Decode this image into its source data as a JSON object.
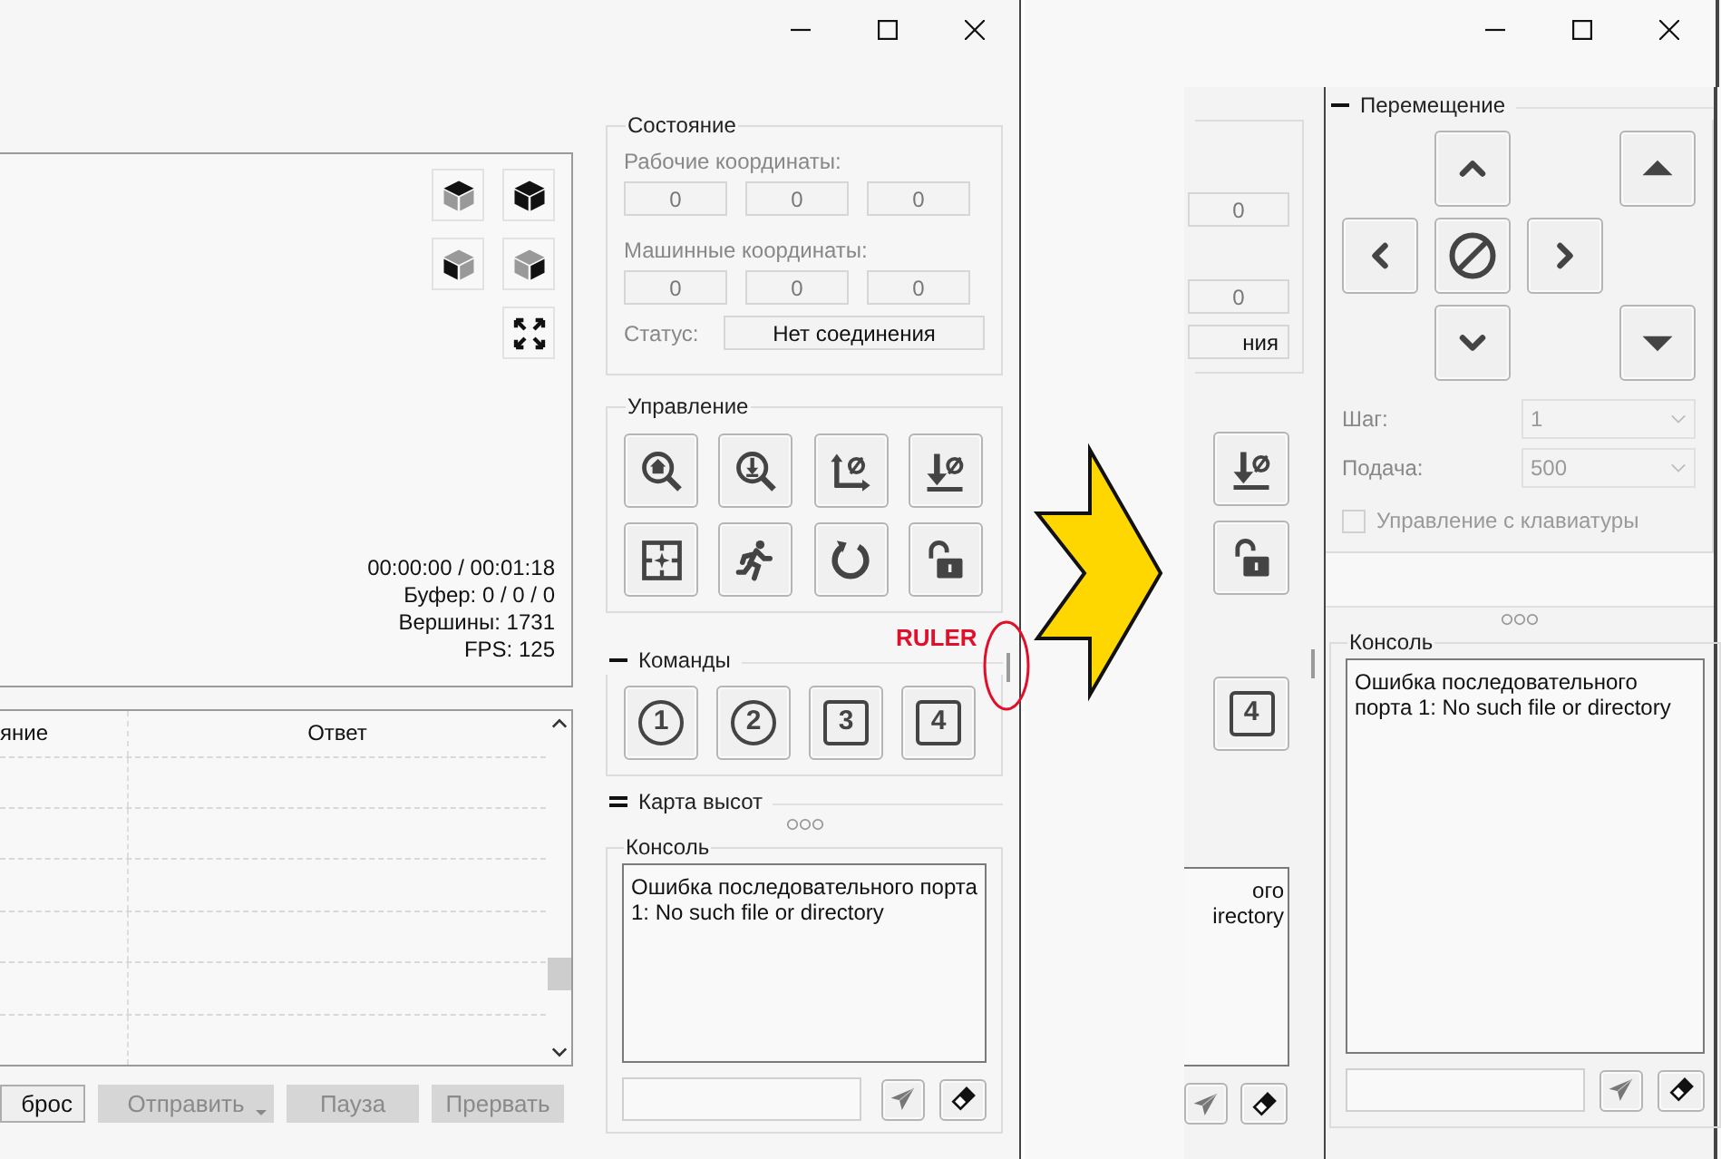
{
  "left_window": {
    "visualizer": {
      "stats": [
        "00:00:00 / 00:01:18",
        "Буфер: 0 / 0 / 0",
        "Вершины: 1731",
        "FPS: 125"
      ]
    },
    "table": {
      "columns": [
        "яние",
        "Ответ"
      ]
    },
    "buttons": [
      {
        "label": "брос",
        "disabled": false,
        "kind": "plain"
      },
      {
        "label": "Отправить",
        "disabled": true,
        "kind": "dropdown"
      },
      {
        "label": "Пауза",
        "disabled": true,
        "kind": "plain"
      },
      {
        "label": "Прервать",
        "disabled": true,
        "kind": "plain"
      }
    ],
    "state": {
      "title": "Состояние",
      "work_label": "Рабочие координаты:",
      "work": [
        "0",
        "0",
        "0"
      ],
      "machine_label": "Машинные координаты:",
      "machine": [
        "0",
        "0",
        "0"
      ],
      "status_label": "Статус:",
      "status": "Нет соединения"
    },
    "control": {
      "title": "Управление"
    },
    "commands": {
      "title": "Команды",
      "expanded": true,
      "buttons": [
        {
          "label": "1",
          "kind": "circle"
        },
        {
          "label": "2",
          "kind": "circle"
        },
        {
          "label": "3",
          "kind": "square"
        },
        {
          "label": "4",
          "kind": "square"
        }
      ]
    },
    "heightmap": {
      "title": "Карта высот",
      "expanded": false
    },
    "console": {
      "title": "Консоль",
      "text": "Ошибка последовательного порта 1: No such file or directory"
    }
  },
  "annotation": {
    "label": "RULER"
  },
  "right_window": {
    "fragment": {
      "work_value": "0",
      "machine_value": "0",
      "status": "ния",
      "button": "4",
      "console_lines": [
        "ого",
        "irectory"
      ]
    },
    "movement": {
      "title": "Перемещение",
      "expanded": true,
      "step_label": "Шаг:",
      "step": "1",
      "feed_label": "Подача:",
      "feed": "500",
      "keyboard": {
        "label": "Управление с клавиатуры",
        "checked": false,
        "disabled": true
      }
    },
    "console": {
      "title": "Консоль",
      "text": "Ошибка последовательного порта 1: No such file or directory"
    }
  }
}
